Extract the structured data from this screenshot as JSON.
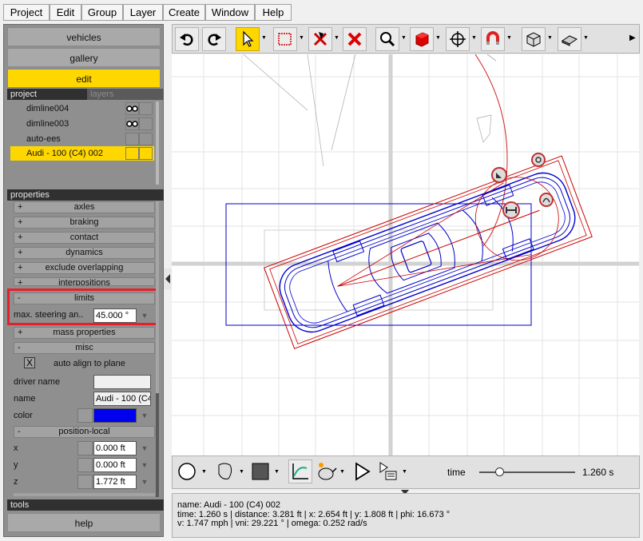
{
  "menu": [
    "Project",
    "Edit",
    "Group",
    "Layer",
    "Create",
    "Window",
    "Help"
  ],
  "nav": {
    "vehicles": "vehicles",
    "gallery": "gallery",
    "edit": "edit"
  },
  "project_tabs": {
    "project": "project",
    "layers": "layers"
  },
  "project_items": [
    {
      "label": "dimline004",
      "icon": "glasses-icon"
    },
    {
      "label": "dimline003",
      "icon": "glasses-icon"
    },
    {
      "label": "auto-ees",
      "icon": ""
    },
    {
      "label": "Audi - 100 (C4) 002",
      "icon": ""
    }
  ],
  "properties_header": "properties",
  "property_groups": [
    {
      "sign": "+",
      "label": "axles"
    },
    {
      "sign": "+",
      "label": "braking"
    },
    {
      "sign": "+",
      "label": "contact"
    },
    {
      "sign": "+",
      "label": "dynamics"
    },
    {
      "sign": "+",
      "label": "exclude overlapping"
    },
    {
      "sign": "+",
      "label": "interpositions"
    },
    {
      "sign": "-",
      "label": "limits"
    },
    {
      "sign": "+",
      "label": "mass properties"
    },
    {
      "sign": "-",
      "label": "misc"
    },
    {
      "sign": "-",
      "label": "position-local"
    }
  ],
  "limits": {
    "steering_label": "max. steering an..",
    "steering_value": "45.000 °"
  },
  "misc": {
    "auto_align_label": "auto align to plane",
    "auto_align_mark": "X",
    "driver_name_label": "driver name",
    "driver_name_value": "",
    "name_label": "name",
    "name_value": "Audi - 100 (C4",
    "color_label": "color",
    "color_value": "#0000ee"
  },
  "position": {
    "x_label": "x",
    "x_value": "0.000 ft",
    "y_label": "y",
    "y_value": "0.000 ft",
    "z_label": "z",
    "z_value": "1.772 ft"
  },
  "tools_header": "tools",
  "help_label": "help",
  "timeline": {
    "label": "time",
    "value": "1.260 s",
    "fraction": 0.07
  },
  "status": {
    "line1": "name: Audi - 100 (C4) 002",
    "line2": "time: 1.260 s | distance: 3.281 ft | x: 2.654 ft | y: 1.808 ft | phi: 16.673 °",
    "line3": "v: 1.747 mph | vni: 29.221 ° | omega: 0.252 rad/s"
  },
  "colors": {
    "accent": "#ffd700",
    "highlight": "#e5202a",
    "car": "#0000cc",
    "frame": "#cc0000"
  }
}
